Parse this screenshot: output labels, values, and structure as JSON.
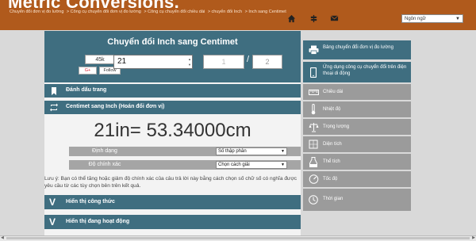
{
  "header": {
    "site_title": "Metric Conversions.",
    "breadcrumb": [
      "Chuyển đổi đơn vị đo lường",
      "> Công cụ chuyển đổi đơn vị đo lường",
      "> Công cụ chuyển đổi chiều dài",
      "> chuyển đổi Inch",
      "> Inch sang Centimet"
    ],
    "language_label": "Ngôn ngữ",
    "icons": [
      "home-icon",
      "directions-icon",
      "mail-icon"
    ]
  },
  "converter": {
    "title": "Chuyển đổi Inch sang Centimet",
    "share_count": "45k",
    "gplus_label": "G+",
    "follow_label": "Follow",
    "input_value": "21",
    "fraction_numerator_placeholder": "1",
    "fraction_denominator_placeholder": "2",
    "bookmark_label": "Đánh dấu trang",
    "swap_label": "Centimet sang Inch (Hoán đổi đơn vị)",
    "result": "21in= 53.34000cm",
    "format_label": "Định dạng",
    "format_value": "Số thập phân",
    "accuracy_label": "Độ chính xác",
    "accuracy_value": "Chọn cách giải",
    "note": "Lưu ý: Bạn có thể tăng hoặc giảm độ chính xác của câu trả lời này bằng cách chọn số chữ số có nghĩa được yêu cầu từ các tùy chọn bên trên kết quả.",
    "show_formula_label": "Hiển thị công thức",
    "show_working_label": "Hiển thị đang hoạt động",
    "expand_glyph": "V"
  },
  "sidebar": {
    "items": [
      {
        "label": "Bảng chuyển đổi đơn vị đo lường",
        "icon": "printer-icon",
        "style": "teal"
      },
      {
        "label": "Ứng dụng công cụ chuyển đổi trên điện thoại di động",
        "icon": "mobile-phone-icon",
        "style": "teal"
      },
      {
        "label": "Chiều dài",
        "icon": "ruler-icon",
        "style": "gray"
      },
      {
        "label": "Nhiệt độ",
        "icon": "thermometer-icon",
        "style": "gray"
      },
      {
        "label": "Trọng lượng",
        "icon": "scale-icon",
        "style": "gray"
      },
      {
        "label": "Diện tích",
        "icon": "area-icon",
        "style": "gray"
      },
      {
        "label": "Thể tích",
        "icon": "volume-icon",
        "style": "gray"
      },
      {
        "label": "Tốc độ",
        "icon": "speed-icon",
        "style": "gray"
      },
      {
        "label": "Thời gian",
        "icon": "clock-icon",
        "style": "gray"
      }
    ]
  },
  "colors": {
    "header": "#b05a1c",
    "teal": "#3f6e80",
    "gray": "#9b9b9b"
  }
}
